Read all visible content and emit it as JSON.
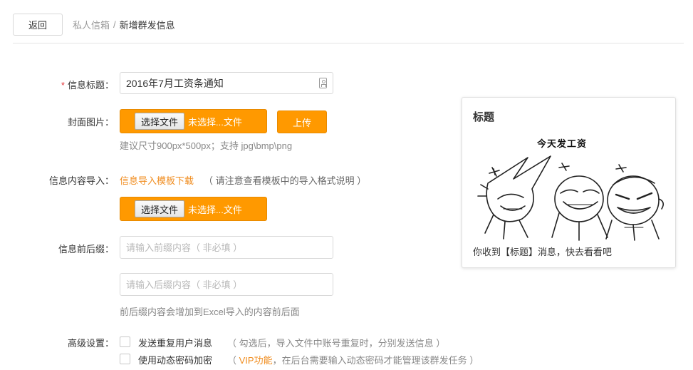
{
  "header": {
    "back_label": "返回",
    "crumb_parent": "私人信箱",
    "crumb_sep": "/",
    "crumb_current": "新增群发信息"
  },
  "form": {
    "title_label": "信息标题：",
    "title_required_mark": "*",
    "title_value": "2016年7月工资条通知",
    "cover_label": "封面图片：",
    "file_button_label": "选择文件",
    "file_status": "未选择...文件",
    "upload_label": "上传",
    "cover_hint": "建议尺寸900px*500px；支持 jpg\\bmp\\png",
    "import_label": "信息内容导入：",
    "template_link": "信息导入模板下载",
    "template_note": "（ 请注意查看模板中的导入格式说明 ）",
    "affix_label": "信息前后缀：",
    "prefix_placeholder": "请输入前缀内容（ 非必填 ）",
    "suffix_placeholder": "请输入后缀内容（ 非必填 ）",
    "affix_hint": "前后缀内容会增加到Excel导入的内容前后面",
    "advanced_label": "高级设置：",
    "opt_resend_label": "发送重复用户消息",
    "opt_resend_note": "（ 勾选后，导入文件中账号重复时，分别发送信息 ）",
    "opt_dynpwd_label": "使用动态密码加密",
    "opt_dynpwd_vip": "VIP功能",
    "opt_dynpwd_note_open": "（ ",
    "opt_dynpwd_note_rest": "，在后台需要输入动态密码才能管理该群发任务 ）"
  },
  "preview": {
    "title": "标题",
    "banner": "今天发工资",
    "message": "你收到【标题】消息，快去看看吧"
  },
  "colors": {
    "accent_orange": "#ff9900",
    "link_orange": "#f08c1e",
    "required_red": "#e4393c"
  },
  "icons": {
    "title_field_icon": "id-card-icon"
  }
}
